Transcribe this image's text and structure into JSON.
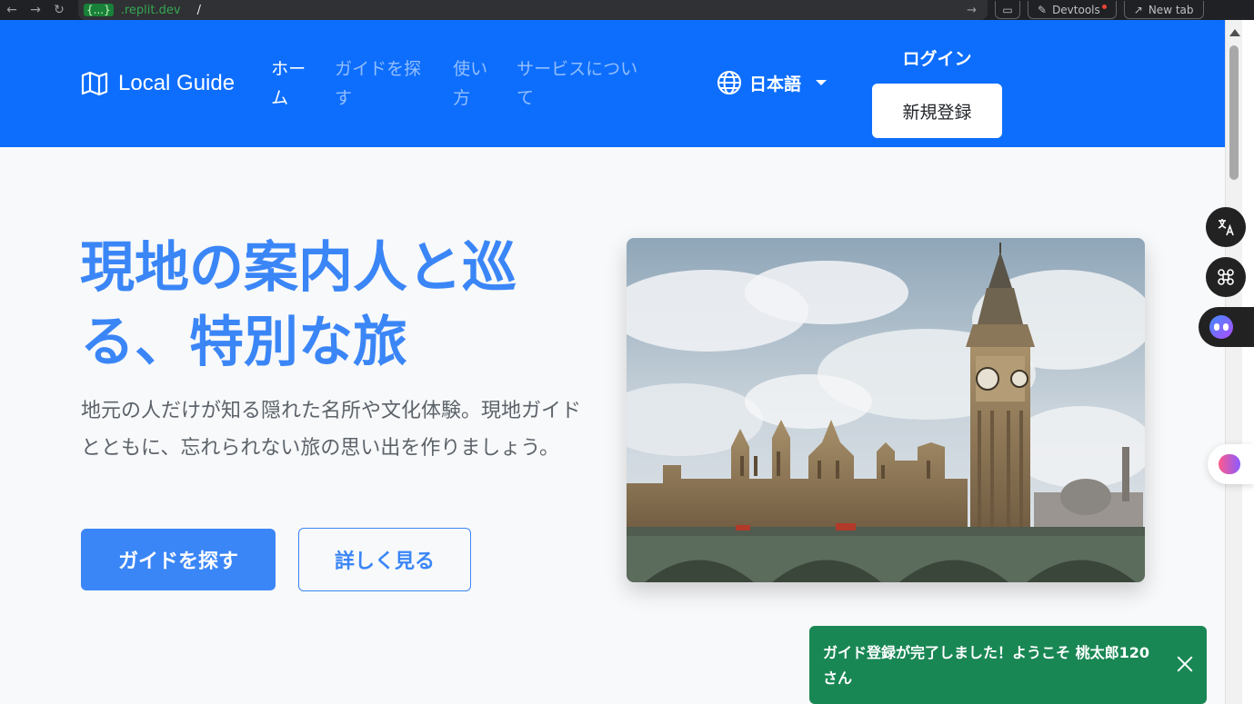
{
  "browser": {
    "ext_badge": "{...}",
    "url_domain": ".replit.dev",
    "url_path": "/",
    "devtools_label": "Devtools",
    "new_tab_label": "New tab"
  },
  "navbar": {
    "brand": "Local Guide",
    "links": [
      {
        "label": "ホーム",
        "active": true
      },
      {
        "label": "ガイドを探す",
        "active": false
      },
      {
        "label": "使い方",
        "active": false
      },
      {
        "label": "サービスについて",
        "active": false
      }
    ],
    "language": "日本語",
    "login": "ログイン",
    "register": "新規登録"
  },
  "hero": {
    "title": "現地の案内人と巡る、特別な旅",
    "description": "地元の人だけが知る隠れた名所や文化体験。現地ガイドとともに、忘れられない旅の思い出を作りましょう。",
    "primary_button": "ガイドを探す",
    "secondary_button": "詳しく見る"
  },
  "toast": {
    "message": "ガイド登録が完了しました！ようこそ 桃太郎120 さん"
  },
  "colors": {
    "navbar": "#0d6efd",
    "accent": "#3b86f7",
    "toast": "#198754"
  }
}
